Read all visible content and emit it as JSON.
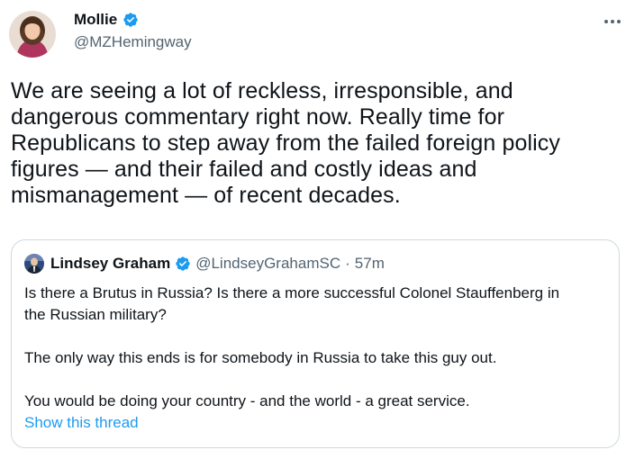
{
  "author": {
    "name": "Mollie",
    "handle": "@MZHemingway",
    "verified": true
  },
  "tweet": {
    "text": "We are seeing a lot of reckless, irresponsible, and\ndangerous commentary right now. Really time for\nRepublicans to step away from the failed foreign policy\nfigures — and their failed and costly ideas and\nmismanagement — of recent decades."
  },
  "quoted": {
    "name": "Lindsey Graham",
    "handle": "@LindseyGrahamSC",
    "separator": "·",
    "time": "57m",
    "verified": true,
    "text": "Is there a Brutus in Russia?  Is there a more successful Colonel Stauffenberg in\nthe Russian military?\n\nThe only way this ends is for somebody in Russia to take this guy out.\n\nYou would be doing your country - and the world - a great service.",
    "show_thread": "Show this thread"
  },
  "colors": {
    "accent": "#1d9bf0",
    "secondary_text": "#536471",
    "border": "#cfd9de"
  },
  "icons": {
    "more": "more-icon",
    "verified": "verified-badge-icon"
  }
}
